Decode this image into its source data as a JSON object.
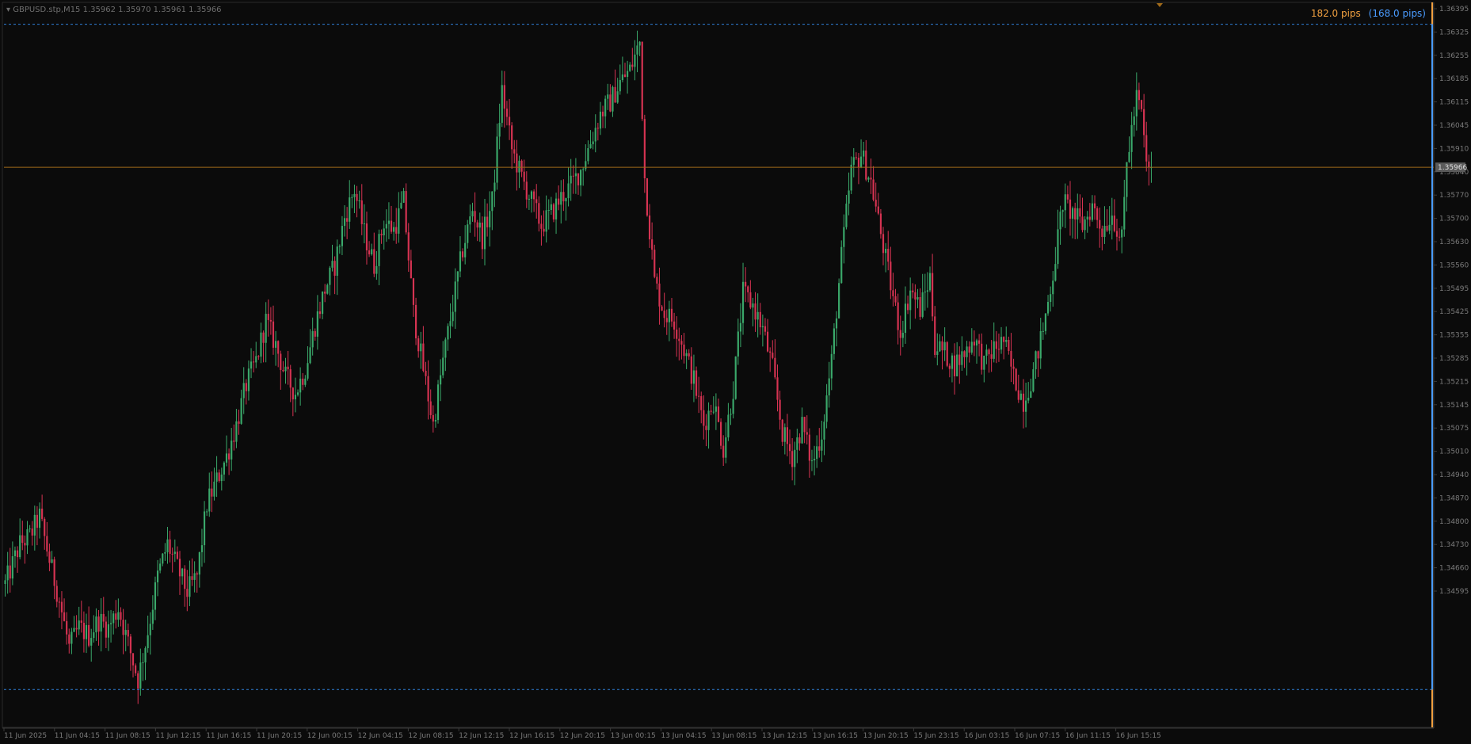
{
  "header": {
    "symbol_info": "GBPUSD.stp,M15  1.35962 1.35970 1.35961 1.35966"
  },
  "pips": {
    "orange_text": "182.0 pips",
    "blue_text": "(168.0 pips)"
  },
  "colors": {
    "background": "#0b0b0b",
    "bull": "#3aa86a",
    "bear": "#d63352",
    "grid_text": "#7a7a7a",
    "current_price_line": "#a06a1a",
    "dashed_level": "#2f7fd8",
    "orange_accent": "#f0a040",
    "blue_accent": "#4a9cff",
    "axis_line": "#3a3a3a"
  },
  "chart_data": {
    "type": "candlestick",
    "ylim": [
      1.3456,
      1.3638
    ],
    "y_ticks": [
      "1.36395",
      "1.36325",
      "1.36255",
      "1.36185",
      "1.36115",
      "1.36045",
      "1.35910",
      "1.35840",
      "1.35770",
      "1.35700",
      "1.35630",
      "1.35560",
      "1.35495",
      "1.35425",
      "1.35355",
      "1.35285",
      "1.35215",
      "1.35145",
      "1.35075",
      "1.35010",
      "1.34940",
      "1.34870",
      "1.34800",
      "1.34730",
      "1.34660",
      "1.34595"
    ],
    "x_ticks": [
      "11 Jun 2025",
      "11 Jun 04:15",
      "11 Jun 08:15",
      "11 Jun 12:15",
      "11 Jun 16:15",
      "11 Jun 20:15",
      "12 Jun 00:15",
      "12 Jun 04:15",
      "12 Jun 08:15",
      "12 Jun 12:15",
      "12 Jun 16:15",
      "12 Jun 20:15",
      "13 Jun 00:15",
      "13 Jun 04:15",
      "13 Jun 08:15",
      "13 Jun 12:15",
      "13 Jun 16:15",
      "13 Jun 20:15",
      "15 Jun 23:15",
      "16 Jun 03:15",
      "16 Jun 07:15",
      "16 Jun 11:15",
      "16 Jun 15:15"
    ],
    "current_price": 1.35966,
    "current_price_label": "1.35966",
    "dashed_levels": [
      1.36325,
      1.34655
    ],
    "close_path": [
      [
        0,
        1.3492
      ],
      [
        6,
        1.3502
      ],
      [
        10,
        1.3504
      ],
      [
        14,
        1.3509
      ],
      [
        18,
        1.3498
      ],
      [
        22,
        1.3488
      ],
      [
        26,
        1.3476
      ],
      [
        30,
        1.3481
      ],
      [
        34,
        1.3479
      ],
      [
        38,
        1.3483
      ],
      [
        42,
        1.3481
      ],
      [
        46,
        1.3486
      ],
      [
        50,
        1.3477
      ],
      [
        54,
        1.3468
      ],
      [
        58,
        1.348
      ],
      [
        62,
        1.3494
      ],
      [
        66,
        1.3502
      ],
      [
        70,
        1.3496
      ],
      [
        74,
        1.349
      ],
      [
        78,
        1.3494
      ],
      [
        82,
        1.3512
      ],
      [
        86,
        1.3518
      ],
      [
        90,
        1.3524
      ],
      [
        94,
        1.3532
      ],
      [
        98,
        1.3542
      ],
      [
        102,
        1.3548
      ],
      [
        106,
        1.3558
      ],
      [
        110,
        1.3552
      ],
      [
        114,
        1.3544
      ],
      [
        118,
        1.354
      ],
      [
        122,
        1.3546
      ],
      [
        126,
        1.3557
      ],
      [
        130,
        1.3566
      ],
      [
        134,
        1.3572
      ],
      [
        138,
        1.3584
      ],
      [
        142,
        1.3591
      ],
      [
        146,
        1.358
      ],
      [
        150,
        1.3572
      ],
      [
        154,
        1.3583
      ],
      [
        158,
        1.3581
      ],
      [
        162,
        1.3588
      ],
      [
        166,
        1.356
      ],
      [
        170,
        1.3546
      ],
      [
        174,
        1.3532
      ],
      [
        178,
        1.3548
      ],
      [
        182,
        1.3562
      ],
      [
        186,
        1.3576
      ],
      [
        190,
        1.3586
      ],
      [
        194,
        1.3579
      ],
      [
        198,
        1.3588
      ],
      [
        202,
        1.3616
      ],
      [
        206,
        1.3601
      ],
      [
        210,
        1.3594
      ],
      [
        214,
        1.3588
      ],
      [
        218,
        1.3582
      ],
      [
        222,
        1.3585
      ],
      [
        226,
        1.3589
      ],
      [
        230,
        1.3592
      ],
      [
        234,
        1.3596
      ],
      [
        238,
        1.3603
      ],
      [
        242,
        1.361
      ],
      [
        246,
        1.3613
      ],
      [
        250,
        1.3618
      ],
      [
        254,
        1.3621
      ],
      [
        258,
        1.3628
      ],
      [
        260,
        1.3594
      ],
      [
        264,
        1.3568
      ],
      [
        268,
        1.356
      ],
      [
        272,
        1.3558
      ],
      [
        276,
        1.3551
      ],
      [
        280,
        1.3543
      ],
      [
        284,
        1.3532
      ],
      [
        288,
        1.3538
      ],
      [
        292,
        1.3526
      ],
      [
        296,
        1.3541
      ],
      [
        300,
        1.3565
      ],
      [
        304,
        1.3562
      ],
      [
        308,
        1.3556
      ],
      [
        312,
        1.3546
      ],
      [
        316,
        1.353
      ],
      [
        320,
        1.3524
      ],
      [
        324,
        1.3532
      ],
      [
        328,
        1.3522
      ],
      [
        332,
        1.353
      ],
      [
        336,
        1.3548
      ],
      [
        340,
        1.3574
      ],
      [
        344,
        1.3596
      ],
      [
        348,
        1.36
      ],
      [
        352,
        1.3593
      ],
      [
        356,
        1.358
      ],
      [
        360,
        1.3567
      ],
      [
        364,
        1.3555
      ],
      [
        368,
        1.3566
      ],
      [
        372,
        1.3561
      ],
      [
        376,
        1.3569
      ],
      [
        378,
        1.3552
      ],
      [
        382,
        1.355
      ],
      [
        386,
        1.3547
      ],
      [
        390,
        1.355
      ],
      [
        394,
        1.3554
      ],
      [
        398,
        1.3547
      ],
      [
        402,
        1.3551
      ],
      [
        406,
        1.3553
      ],
      [
        410,
        1.3544
      ],
      [
        414,
        1.3538
      ],
      [
        418,
        1.3545
      ],
      [
        422,
        1.3556
      ],
      [
        426,
        1.357
      ],
      [
        430,
        1.3588
      ],
      [
        434,
        1.3585
      ],
      [
        438,
        1.3582
      ],
      [
        442,
        1.3587
      ],
      [
        446,
        1.3581
      ],
      [
        450,
        1.3585
      ],
      [
        454,
        1.3578
      ],
      [
        456,
        1.3598
      ],
      [
        460,
        1.3614
      ],
      [
        462,
        1.361
      ],
      [
        464,
        1.3597
      ],
      [
        466,
        1.35966
      ]
    ]
  }
}
